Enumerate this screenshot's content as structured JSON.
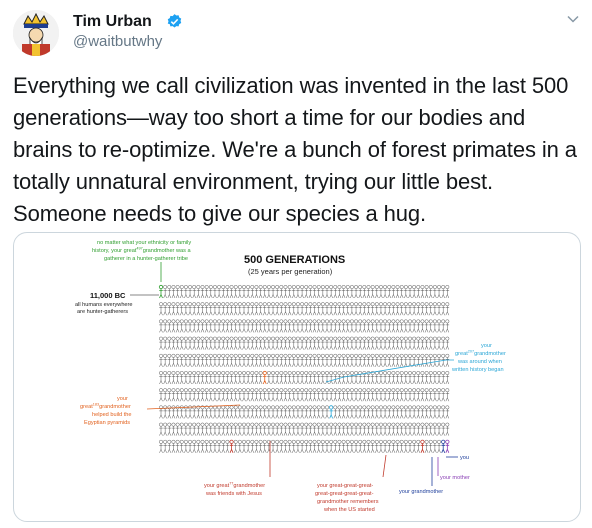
{
  "author": {
    "name": "Tim Urban",
    "handle": "@waitbutwhy",
    "avatar_icon": "king-card-avatar-icon",
    "verified_color": "#1da1f2"
  },
  "tweet": {
    "text": "Everything we call civilization was invented in the last 500 generations—way too short a time for our bodies and brains to re-optimize. We're a bunch of forest primates in a totally unnatural environment, trying our little best. Someone needs to give our species a hug."
  },
  "infographic": {
    "title": "500 GENERATIONS",
    "subtitle": "(25 years per generation)",
    "start_label": "11,000 BC",
    "start_note": [
      "all humans everywhere",
      "are hunter-gatherers"
    ],
    "hunter_note": [
      "no matter what your ethnicity or family",
      "history, your great",
      "grandmother was a",
      "gatherer in a hunter-gatherer tribe"
    ],
    "hunter_exp": "497",
    "egypt_note": [
      "your",
      "great",
      "grandmother",
      "helped build the",
      "Egyptian pyramids"
    ],
    "egypt_exp": "183",
    "history_note": [
      "your",
      "great",
      "grandmother",
      "was around when",
      "written history began"
    ],
    "history_exp": "207",
    "jesus_note": [
      "your great",
      "grandmother",
      "was friends with Jesus"
    ],
    "jesus_exp": "77",
    "us_note": [
      "your great-great-great-",
      "great-great-great-great-",
      "grandmother remembers",
      "when the US started"
    ],
    "grandmother": "your grandmother",
    "mother": "your mother",
    "you": "you",
    "colors": {
      "green": "#2f9e2f",
      "orange": "#e2621f",
      "blue": "#2aa6d6",
      "red": "#c0392b",
      "navy": "#1f3f9c",
      "purple": "#8a3fb5"
    }
  }
}
